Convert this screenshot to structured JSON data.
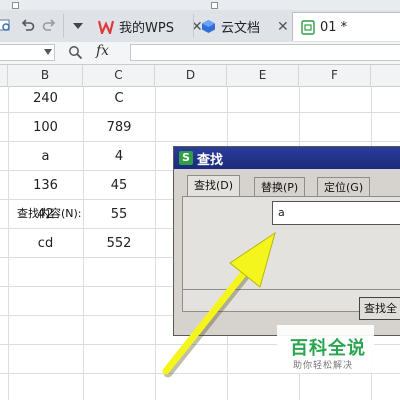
{
  "tabbar": {
    "tabs": [
      {
        "label": "我的WPS",
        "close": "✕"
      },
      {
        "label": "云文档",
        "close": "✕"
      },
      {
        "label": "01 *"
      }
    ],
    "icons": [
      "save-icon",
      "undo-icon",
      "redo-icon",
      "dropdown-icon",
      "wps-logo-icon",
      "cloud-doc-icon",
      "sheet-doc-icon"
    ]
  },
  "formula_bar": {
    "fx_label": "fx",
    "cell_value": ""
  },
  "columns": [
    "B",
    "C",
    "D",
    "E",
    "F"
  ],
  "rows": [
    {
      "B": "240",
      "C": "C"
    },
    {
      "B": "100",
      "C": "789"
    },
    {
      "B": "a",
      "C": "4"
    },
    {
      "B": "136",
      "C": "45"
    },
    {
      "B": "42",
      "C": "55"
    },
    {
      "B": "cd",
      "C": "552"
    }
  ],
  "dialog": {
    "title": "查找",
    "tabs": [
      "查找(D)",
      "替换(P)",
      "定位(G)"
    ],
    "active_tab": "查找(D)",
    "find_label": "查找内容(N):",
    "find_value": "a",
    "find_all_button": "查找全"
  },
  "watermark": {
    "main": "百科全说",
    "sub": "助你轻松解决"
  },
  "colors": {
    "title_bar": "#1b2a7a",
    "arrow": "#f5f51e",
    "watermark_green": "#2aa54d"
  }
}
